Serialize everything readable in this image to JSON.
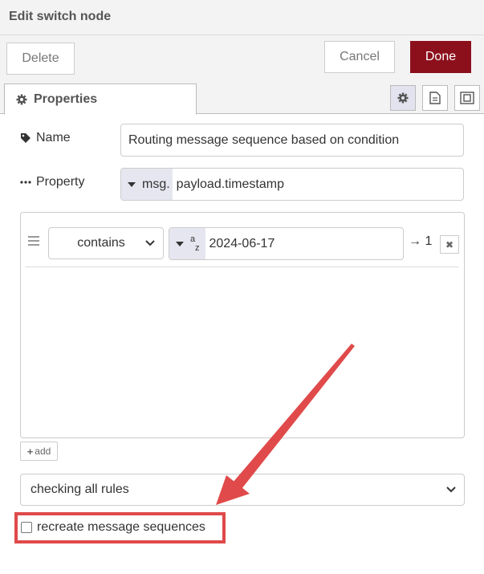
{
  "header": {
    "title": "Edit switch node"
  },
  "buttons": {
    "delete": "Delete",
    "cancel": "Cancel",
    "done": "Done"
  },
  "tabs": {
    "properties": "Properties"
  },
  "form": {
    "name_label": "Name",
    "name_value": "Routing message sequence based on condition",
    "property_label": "Property",
    "property_type": "msg.",
    "property_value": "payload.timestamp"
  },
  "rules": [
    {
      "operator": "contains",
      "value_type": "a z",
      "value": "2024-06-17",
      "output": "→ 1"
    }
  ],
  "add_label": "add",
  "check_mode": "checking all rules",
  "recreate_label": "recreate message sequences",
  "colors": {
    "done_button": "#8c101c",
    "annotation": "#e04a4a"
  }
}
